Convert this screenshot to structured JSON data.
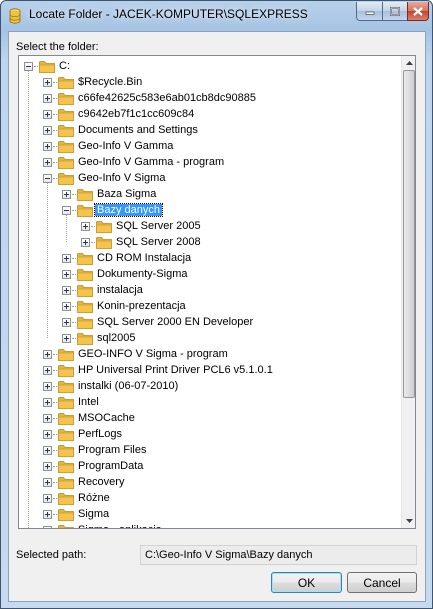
{
  "window": {
    "title": "Locate Folder - JACEK-KOMPUTER\\SQLEXPRESS"
  },
  "dialog": {
    "select_label": "Select the folder:",
    "selected_path_label": "Selected path:",
    "selected_path_value": "C:\\Geo-Info V Sigma\\Bazy danych",
    "ok_label": "OK",
    "cancel_label": "Cancel"
  },
  "tree": [
    {
      "label": "C:",
      "level": 0,
      "expander": "minus"
    },
    {
      "label": "$Recycle.Bin",
      "level": 1,
      "expander": "plus"
    },
    {
      "label": "c66fe42625c583e6ab01cb8dc90885",
      "level": 1,
      "expander": "plus"
    },
    {
      "label": "c9642eb7f1c1cc609c84",
      "level": 1,
      "expander": "plus"
    },
    {
      "label": "Documents and Settings",
      "level": 1,
      "expander": "plus"
    },
    {
      "label": "Geo-Info V Gamma",
      "level": 1,
      "expander": "plus"
    },
    {
      "label": "Geo-Info V Gamma - program",
      "level": 1,
      "expander": "plus"
    },
    {
      "label": "Geo-Info V Sigma",
      "level": 1,
      "expander": "minus"
    },
    {
      "label": "Baza Sigma",
      "level": 2,
      "expander": "plus"
    },
    {
      "label": "Bazy danych",
      "level": 2,
      "expander": "minus",
      "selected": true
    },
    {
      "label": "SQL Server 2005",
      "level": 3,
      "expander": "plus"
    },
    {
      "label": "SQL Server 2008",
      "level": 3,
      "expander": "plus"
    },
    {
      "label": "CD ROM Instalacja",
      "level": 2,
      "expander": "plus"
    },
    {
      "label": "Dokumenty-Sigma",
      "level": 2,
      "expander": "plus"
    },
    {
      "label": "instalacja",
      "level": 2,
      "expander": "plus"
    },
    {
      "label": "Konin-prezentacja",
      "level": 2,
      "expander": "plus"
    },
    {
      "label": "SQL Server 2000 EN Developer",
      "level": 2,
      "expander": "plus"
    },
    {
      "label": "sql2005",
      "level": 2,
      "expander": "plus"
    },
    {
      "label": "GEO-INFO V Sigma - program",
      "level": 1,
      "expander": "plus"
    },
    {
      "label": "HP Universal Print Driver PCL6 v5.1.0.1",
      "level": 1,
      "expander": "plus"
    },
    {
      "label": "instalki (06-07-2010)",
      "level": 1,
      "expander": "plus"
    },
    {
      "label": "Intel",
      "level": 1,
      "expander": "plus"
    },
    {
      "label": "MSOCache",
      "level": 1,
      "expander": "plus"
    },
    {
      "label": "PerfLogs",
      "level": 1,
      "expander": "plus"
    },
    {
      "label": "Program Files",
      "level": 1,
      "expander": "plus"
    },
    {
      "label": "ProgramData",
      "level": 1,
      "expander": "plus"
    },
    {
      "label": "Recovery",
      "level": 1,
      "expander": "plus"
    },
    {
      "label": "Różne",
      "level": 1,
      "expander": "plus"
    },
    {
      "label": "Sigma",
      "level": 1,
      "expander": "plus"
    },
    {
      "label": "Sigma - aplikacja",
      "level": 1,
      "expander": "plus"
    }
  ],
  "colors": {
    "selection": "#3399ff",
    "folder": "#f5c54b"
  }
}
